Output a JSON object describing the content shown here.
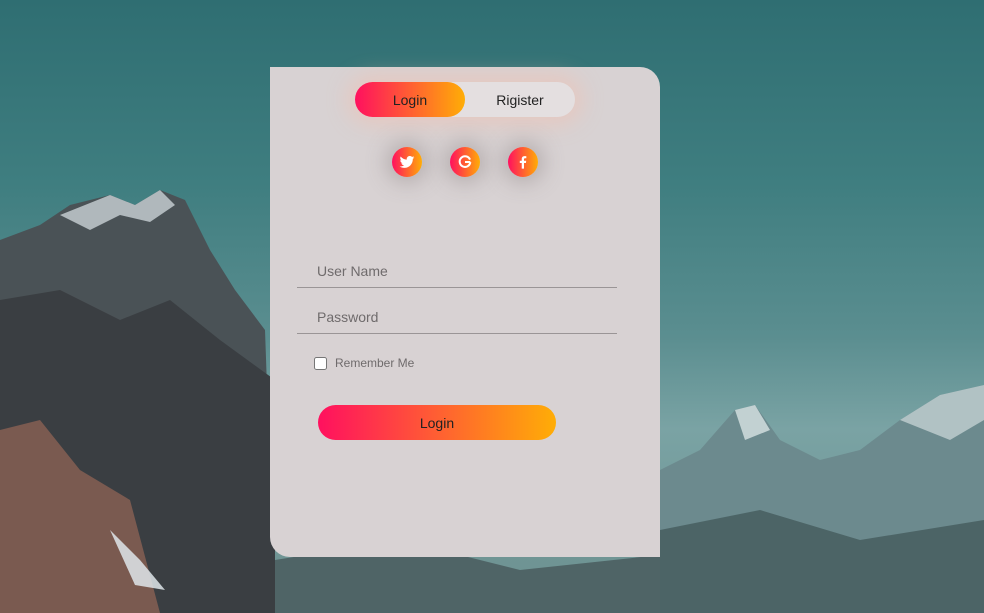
{
  "form": {
    "tabs": {
      "login_label": "Login",
      "register_label": "Rigister",
      "active": "login"
    },
    "social": [
      {
        "icon": "twitter-icon"
      },
      {
        "icon": "google-icon"
      },
      {
        "icon": "facebook-icon"
      }
    ],
    "username": {
      "placeholder": "User Name",
      "value": ""
    },
    "password": {
      "placeholder": "Password",
      "value": ""
    },
    "remember": {
      "label": "Remember Me",
      "checked": false
    },
    "submit_label": "Login"
  },
  "colors": {
    "gradient_start": "#ff105f",
    "gradient_end": "#ffad06",
    "card": "#d8d2d3"
  }
}
